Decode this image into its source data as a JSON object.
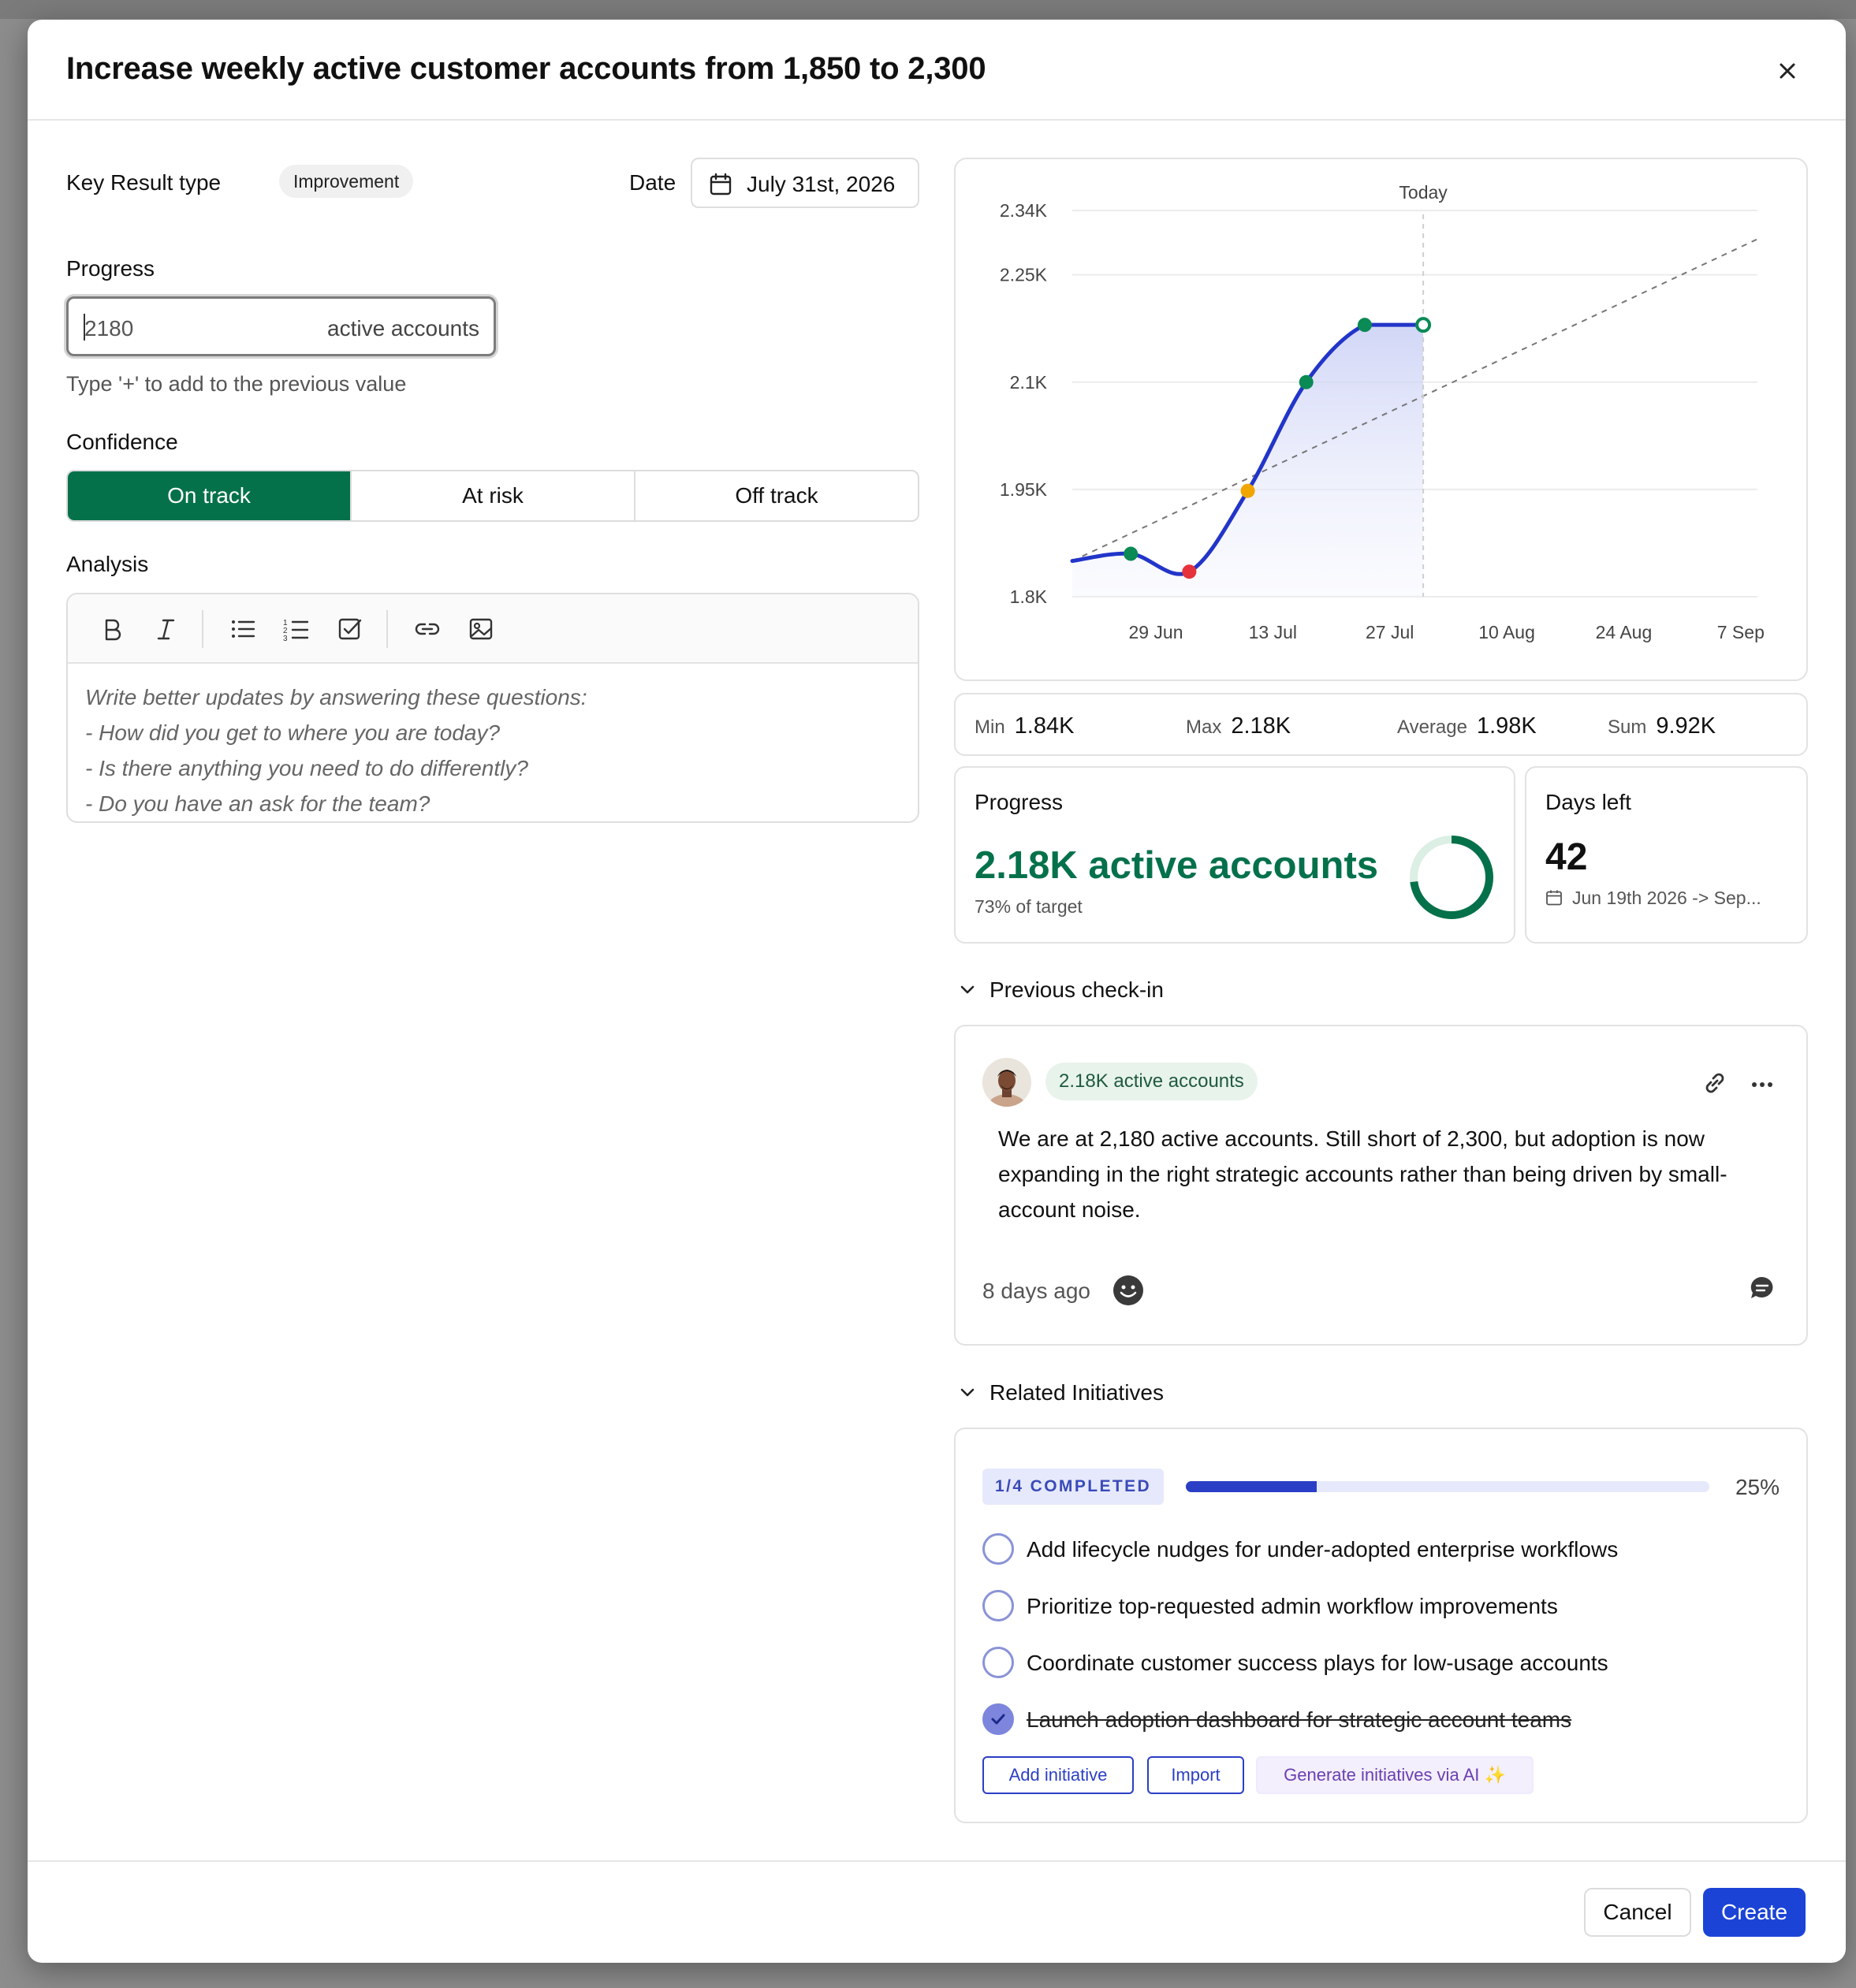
{
  "modal": {
    "title": "Increase weekly active customer accounts from 1,850 to 2,300"
  },
  "form": {
    "kr_type_label": "Key Result type",
    "kr_type_value": "Improvement",
    "date_label": "Date",
    "date_value": "July 31st, 2026",
    "progress_label": "Progress",
    "progress_value": "2180",
    "progress_unit": "active accounts",
    "progress_hint": "Type '+' to add to the previous value",
    "confidence_label": "Confidence",
    "confidence_options": [
      "On track",
      "At risk",
      "Off track"
    ],
    "confidence_selected": "On track",
    "analysis_label": "Analysis",
    "analysis_placeholder_lines": [
      "Write better updates by answering these questions:",
      "- How did you get to where you are today?",
      "- Is there anything you need to do differently?",
      "- Do you have an ask for the team?"
    ],
    "toolbar_icons": [
      "bold-icon",
      "italic-icon",
      "bullet-list-icon",
      "numbered-list-icon",
      "checklist-icon",
      "link-icon",
      "image-icon"
    ]
  },
  "chart_data": {
    "type": "line",
    "title": "",
    "annotation": "Today",
    "x_ticks": [
      "29 Jun",
      "13 Jul",
      "27 Jul",
      "10 Aug",
      "24 Aug",
      "7 Sep"
    ],
    "y_ticks": [
      "2.34K",
      "2.25K",
      "2.1K",
      "1.95K",
      "1.8K"
    ],
    "ylim": [
      1800,
      2340
    ],
    "series": [
      {
        "points": [
          {
            "x": "Jun 19",
            "y": 1850
          },
          {
            "x": "Jun 26",
            "y": 1860
          },
          {
            "x": "Jul 3",
            "y": 1835
          },
          {
            "x": "Jul 10",
            "y": 1948
          },
          {
            "x": "Jul 17",
            "y": 2100
          },
          {
            "x": "Jul 24",
            "y": 2180
          },
          {
            "x": "Jul 31",
            "y": 2180
          }
        ],
        "point_colors": [
          "",
          "#0a8a55",
          "#e5323b",
          "#f0a500",
          "#0a8a55",
          "#0a8a55",
          "#0a8a55"
        ]
      },
      {
        "points": [
          {
            "x": "Jun 19",
            "y": 1850
          },
          {
            "x": "Sep 9",
            "y": 2300
          }
        ],
        "style": "dashed"
      }
    ],
    "grid": true,
    "legend": "none"
  },
  "stats": {
    "min_label": "Min",
    "min_value": "1.84K",
    "max_label": "Max",
    "max_value": "2.18K",
    "avg_label": "Average",
    "avg_value": "1.98K",
    "sum_label": "Sum",
    "sum_value": "9.92K"
  },
  "progress_card": {
    "title": "Progress",
    "value": "2.18K active accounts",
    "sub": "73% of target",
    "fraction": 0.73
  },
  "days_card": {
    "title": "Days left",
    "value": "42",
    "range": "Jun 19th 2026 -> Sep..."
  },
  "previous_checkin": {
    "heading": "Previous check-in",
    "badge": "2.18K active accounts",
    "text": "We are at 2,180 active accounts. Still short of 2,300, but adoption is now expanding in the right strategic accounts rather than being driven by small-account noise.",
    "time": "8 days ago"
  },
  "initiatives": {
    "heading": "Related Initiatives",
    "completed_badge": "1/4 COMPLETED",
    "percent": "25%",
    "fraction": 0.25,
    "items": [
      {
        "label": "Add lifecycle nudges for under-adopted enterprise workflows",
        "done": false
      },
      {
        "label": "Prioritize top-requested admin workflow improvements",
        "done": false
      },
      {
        "label": "Coordinate customer success plays for low-usage accounts",
        "done": false
      },
      {
        "label": "Launch adoption dashboard for strategic account teams",
        "done": true
      }
    ],
    "add_label": "Add initiative",
    "import_label": "Import",
    "ai_label": "Generate initiatives via AI ✨"
  },
  "footer": {
    "cancel_label": "Cancel",
    "create_label": "Create"
  },
  "colors": {
    "accent_green": "#05714a",
    "primary_blue": "#1b44d6",
    "chart_line": "#2235c9"
  }
}
